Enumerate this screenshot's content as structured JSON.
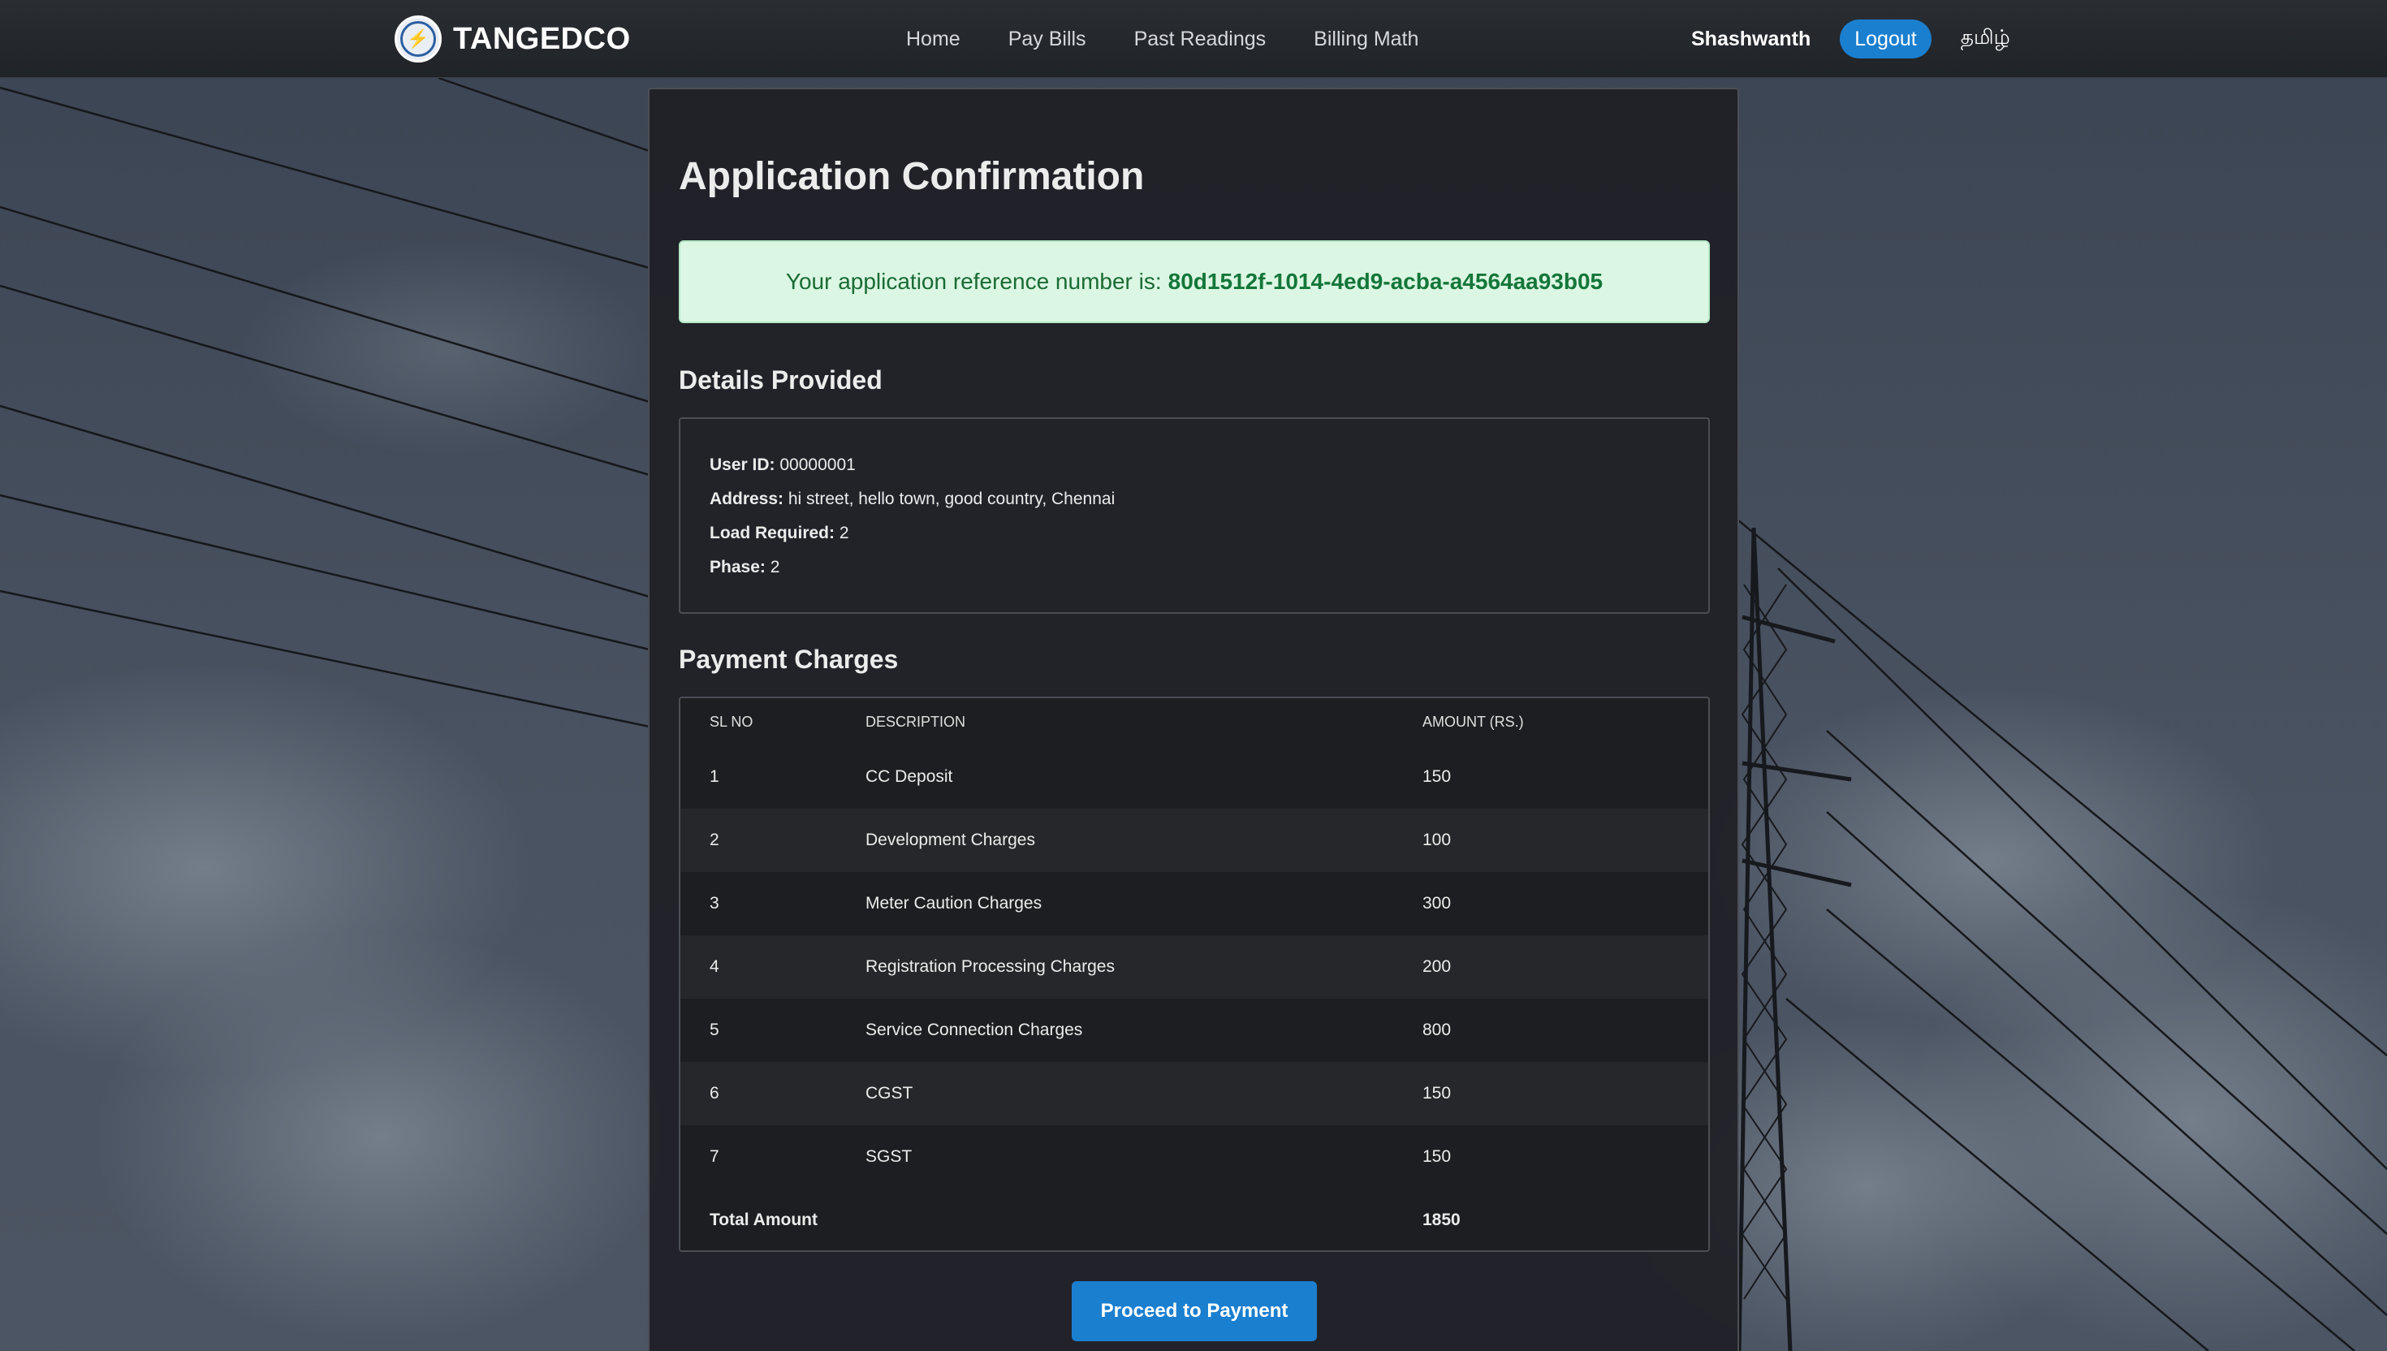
{
  "header": {
    "brand": "TANGEDCO",
    "nav": [
      "Home",
      "Pay Bills",
      "Past Readings",
      "Billing Math"
    ],
    "username": "Shashwanth",
    "logout_label": "Logout",
    "language": "தமிழ்"
  },
  "main": {
    "title": "Application Confirmation",
    "reference_prefix": "Your application reference number is:",
    "reference_number": "80d1512f-1014-4ed9-acba-a4564aa93b05",
    "details_heading": "Details Provided",
    "details": [
      {
        "label": "User ID:",
        "value": "00000001"
      },
      {
        "label": "Address:",
        "value": "hi street, hello town, good country, Chennai"
      },
      {
        "label": "Load Required:",
        "value": "2"
      },
      {
        "label": "Phase:",
        "value": "2"
      }
    ],
    "charges_heading": "Payment Charges",
    "table": {
      "headers": [
        "SL NO",
        "DESCRIPTION",
        "AMOUNT (RS.)"
      ],
      "rows": [
        [
          "1",
          "CC Deposit",
          "150"
        ],
        [
          "2",
          "Development Charges",
          "100"
        ],
        [
          "3",
          "Meter Caution Charges",
          "300"
        ],
        [
          "4",
          "Registration Processing Charges",
          "200"
        ],
        [
          "5",
          "Service Connection Charges",
          "800"
        ],
        [
          "6",
          "CGST",
          "150"
        ],
        [
          "7",
          "SGST",
          "150"
        ]
      ],
      "total_label": "Total Amount",
      "total_value": "1850"
    },
    "pay_label": "Proceed to Payment"
  },
  "colors": {
    "accent": "#1b7fd0",
    "success_bg": "#dbf7e3",
    "success_text": "#14763a"
  }
}
